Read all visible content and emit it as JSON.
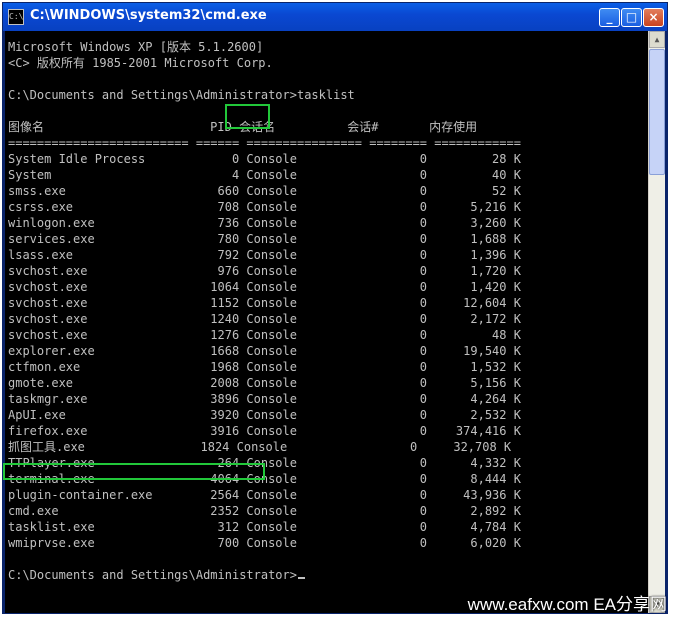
{
  "window": {
    "title": "C:\\WINDOWS\\system32\\cmd.exe",
    "icon": "cmd-icon",
    "icon_text": "C:\\"
  },
  "buttons": {
    "minimize": "_",
    "maximize": "□",
    "close": "×"
  },
  "console_lines": [
    "Microsoft Windows XP [版本 5.1.2600]",
    "<C> 版权所有 1985-2001 Microsoft Corp.",
    "",
    "C:\\Documents and Settings\\Administrator>tasklist",
    "",
    "图像名                       PID 会话名          会话#       内存使用",
    "========================= ====== ================ ======== ============",
    "System Idle Process            0 Console                 0         28 K",
    "System                         4 Console                 0         40 K",
    "smss.exe                     660 Console                 0         52 K",
    "csrss.exe                    708 Console                 0      5,216 K",
    "winlogon.exe                 736 Console                 0      3,260 K",
    "services.exe                 780 Console                 0      1,688 K",
    "lsass.exe                    792 Console                 0      1,396 K",
    "svchost.exe                  976 Console                 0      1,720 K",
    "svchost.exe                 1064 Console                 0      1,420 K",
    "svchost.exe                 1152 Console                 0     12,604 K",
    "svchost.exe                 1240 Console                 0      2,172 K",
    "svchost.exe                 1276 Console                 0         48 K",
    "explorer.exe                1668 Console                 0     19,540 K",
    "ctfmon.exe                  1968 Console                 0      1,532 K",
    "gmote.exe                   2008 Console                 0      5,156 K",
    "taskmgr.exe                 3896 Console                 0      4,264 K",
    "ApUI.exe                    3920 Console                 0      2,532 K",
    "firefox.exe                 3916 Console                 0    374,416 K",
    "抓图工具.exe                1824 Console                 0     32,708 K",
    "TTPlayer.exe                 264 Console                 0      4,332 K",
    "terminal.exe                4064 Console                 0      8,444 K",
    "plugin-container.exe        2564 Console                 0     43,936 K",
    "cmd.exe                     2352 Console                 0      2,892 K",
    "tasklist.exe                 312 Console                 0      4,784 K",
    "wmiprvse.exe                 700 Console                 0      6,020 K",
    "",
    "C:\\Documents and Settings\\Administrator>"
  ],
  "scrollbar": {
    "up_arrow": "▲",
    "down_arrow": "▼"
  },
  "watermark": "www.eafxw.com   EA分享网",
  "colors": {
    "titlebar": "#0a48d2",
    "console_bg": "#000000",
    "console_text": "#c0c0c0",
    "highlight": "#22c83a"
  }
}
